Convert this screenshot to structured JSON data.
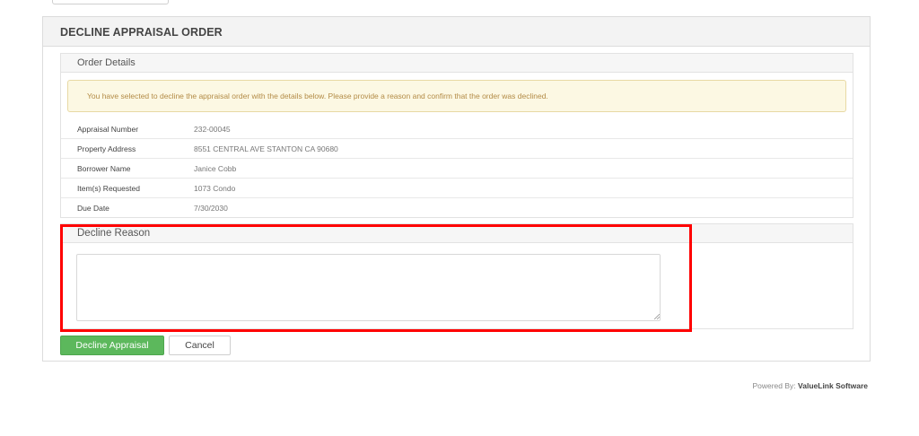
{
  "page": {
    "title": "DECLINE APPRAISAL ORDER"
  },
  "order_details": {
    "heading": "Order Details",
    "alert_text": "You have selected to decline the appraisal order with the details below. Please provide a reason and confirm that the order was declined.",
    "rows": [
      {
        "label": "Appraisal Number",
        "value": "232-00045"
      },
      {
        "label": "Property Address",
        "value": "8551 CENTRAL AVE STANTON CA 90680"
      },
      {
        "label": "Borrower Name",
        "value": "Janice Cobb"
      },
      {
        "label": "Item(s) Requested",
        "value": "1073 Condo"
      },
      {
        "label": "Due Date",
        "value": "7/30/2030"
      }
    ]
  },
  "decline_reason": {
    "heading": "Decline Reason",
    "value": "",
    "placeholder": ""
  },
  "actions": {
    "decline_label": "Decline Appraisal",
    "cancel_label": "Cancel"
  },
  "footer": {
    "powered_by": "Powered By:",
    "brand": "ValueLink Software"
  },
  "colors": {
    "primary_button": "#5cb85c",
    "alert_background": "#fcf8e3",
    "alert_text": "#b38b46",
    "highlight_box": "#ff0000"
  }
}
